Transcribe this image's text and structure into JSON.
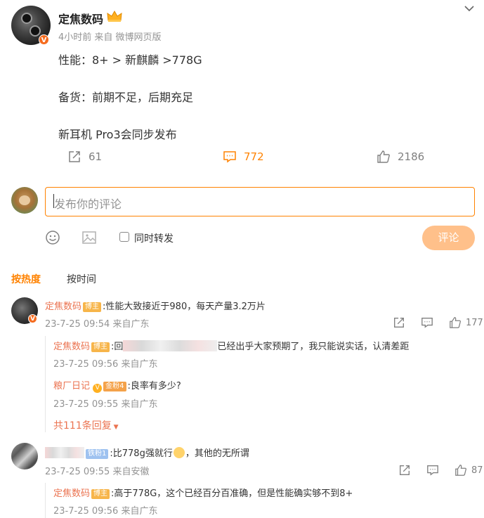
{
  "post": {
    "author": "定焦数码",
    "meta": "4小时前  来自 微博网页版",
    "lines": [
      "性能：8+ > 新麒麟 >778G",
      "备货：前期不足，后期充足",
      "新耳机 Pro3会同步发布"
    ],
    "repost_count": "61",
    "comment_count": "772",
    "like_count": "2186"
  },
  "composer": {
    "placeholder": "发布你的评论",
    "repost_checkbox_label": "同时转发",
    "submit_label": "评论"
  },
  "sort_tabs": {
    "hot": "按热度",
    "time": "按时间"
  },
  "comments": [
    {
      "name": "定焦数码",
      "tag": "博主",
      "text": ":性能大致接近于980，每天产量3.2万片",
      "meta": "23-7-25 09:54 来自广东",
      "likes": "177",
      "replies": [
        {
          "name": "定焦数码",
          "tag": "博主",
          "text_prefix": ":回",
          "text": "已经出乎大家预期了，我只能说实话，认清差距",
          "meta": "23-7-25 09:56 来自广东"
        },
        {
          "name": "粮厂日记",
          "tag": "金粉4",
          "text": ":良率有多少?",
          "meta": "23-7-25 09:55 来自广东"
        }
      ],
      "more_replies": "共111条回复"
    },
    {
      "name": "",
      "tag": "铁粉1",
      "text": ":比778g强就行",
      "text_suffix": "，其他的无所谓",
      "meta": "23-7-25 09:55 来自安徽",
      "likes": "87",
      "replies": [
        {
          "name": "定焦数码",
          "tag": "博主",
          "text": ":高于778G，这个已经百分百准确，但是性能确实够不到8+",
          "meta": "23-7-25 09:56 来自广东"
        }
      ]
    }
  ],
  "colors": {
    "accent": "#ff8200",
    "name": "#eb7350",
    "meta": "#939393"
  },
  "icons": [
    "chevron-down-icon",
    "crown-icon",
    "repost-icon",
    "comment-icon",
    "like-icon",
    "emoji-icon",
    "image-icon"
  ]
}
